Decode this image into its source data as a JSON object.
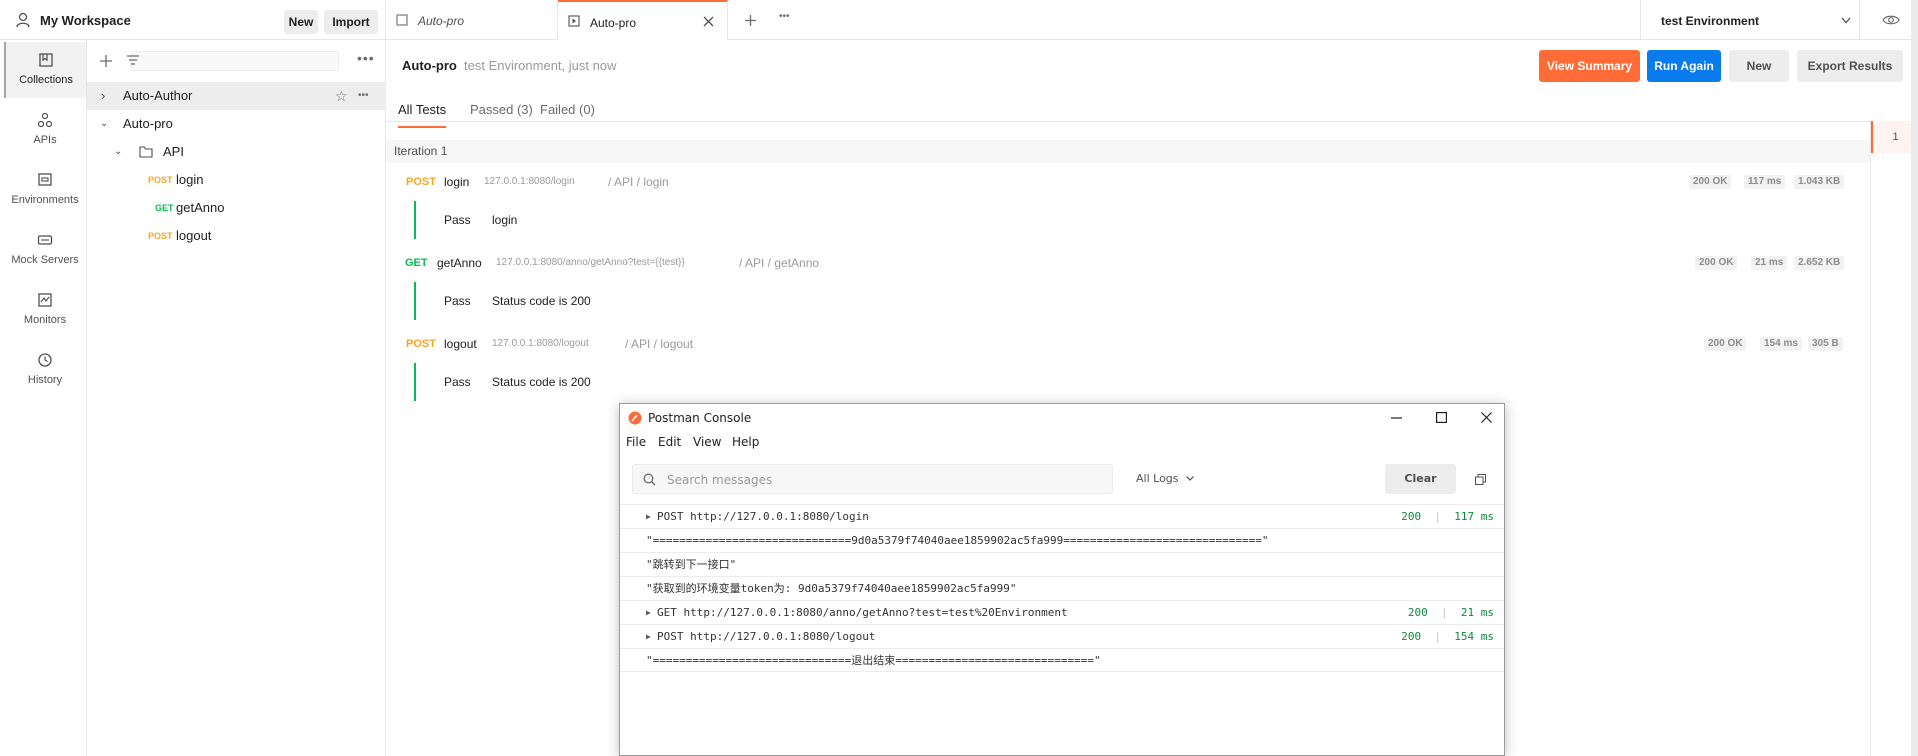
{
  "workspace": {
    "title": "My Workspace",
    "new_label": "New",
    "import_label": "Import"
  },
  "rail": {
    "items": [
      {
        "label": "Collections",
        "icon": "collections-icon"
      },
      {
        "label": "APIs",
        "icon": "apis-icon"
      },
      {
        "label": "Environments",
        "icon": "environments-icon"
      },
      {
        "label": "Mock Servers",
        "icon": "mock-servers-icon"
      },
      {
        "label": "Monitors",
        "icon": "monitors-icon"
      },
      {
        "label": "History",
        "icon": "history-icon"
      }
    ]
  },
  "sidebar": {
    "tree": [
      {
        "label": "Auto-Author"
      },
      {
        "label": "Auto-pro"
      },
      {
        "label": "API"
      },
      {
        "method": "POST",
        "label": "login"
      },
      {
        "method": "GET",
        "label": "getAnno"
      },
      {
        "method": "POST",
        "label": "logout"
      }
    ]
  },
  "tabs": [
    {
      "label": "Auto-pro"
    },
    {
      "label": "Auto-pro"
    }
  ],
  "environment": {
    "selected": "test Environment"
  },
  "runner": {
    "name": "Auto-pro",
    "meta": "test Environment, just now",
    "view_summary": "View Summary",
    "run_again": "Run Again",
    "new_label": "New",
    "export": "Export Results",
    "sub_tabs": [
      "All Tests",
      "Passed (3)",
      "Failed (0)"
    ],
    "iteration_label": "Iteration 1",
    "iteration_number": "1",
    "requests": [
      {
        "method": "POST",
        "name": "login",
        "url": "127.0.0.1:8080/login",
        "path": "/ API / login",
        "status": "200 OK",
        "time": "117 ms",
        "size": "1.043 KB",
        "test_result": "Pass",
        "test_name": "login"
      },
      {
        "method": "GET",
        "name": "getAnno",
        "url": "127.0.0.1:8080/anno/getAnno?test={{test}}",
        "path": "/ API / getAnno",
        "status": "200 OK",
        "time": "21 ms",
        "size": "2.652 KB",
        "test_result": "Pass",
        "test_name": "Status code is 200"
      },
      {
        "method": "POST",
        "name": "logout",
        "url": "127.0.0.1:8080/logout",
        "path": "/ API / logout",
        "status": "200 OK",
        "time": "154 ms",
        "size": "305 B",
        "test_result": "Pass",
        "test_name": "Status code is 200"
      }
    ]
  },
  "console": {
    "title": "Postman Console",
    "menu": [
      "File",
      "Edit",
      "View",
      "Help"
    ],
    "search_placeholder": "Search messages",
    "log_filter": "All Logs",
    "clear_label": "Clear",
    "logs": [
      {
        "text": "POST http://127.0.0.1:8080/login",
        "status": "200",
        "time": "117 ms",
        "expandable": true
      },
      {
        "text": "\"==============================9d0a5379f74040aee1859902ac5fa999==============================\"",
        "expandable": false
      },
      {
        "text": "\"跳转到下一接口\"",
        "expandable": false
      },
      {
        "text": "\"获取到的环境变量token为: 9d0a5379f74040aee1859902ac5fa999\"",
        "expandable": false
      },
      {
        "text": "GET http://127.0.0.1:8080/anno/getAnno?test=test%20Environment",
        "status": "200",
        "time": "21 ms",
        "expandable": true
      },
      {
        "text": "POST http://127.0.0.1:8080/logout",
        "status": "200",
        "time": "154 ms",
        "expandable": true
      },
      {
        "text": "\"==============================退出结束==============================\"",
        "expandable": false
      }
    ]
  },
  "colors": {
    "accent": "#ff6c37",
    "primary": "#097bed",
    "post": "#f5a623",
    "get": "#0cbb52"
  }
}
